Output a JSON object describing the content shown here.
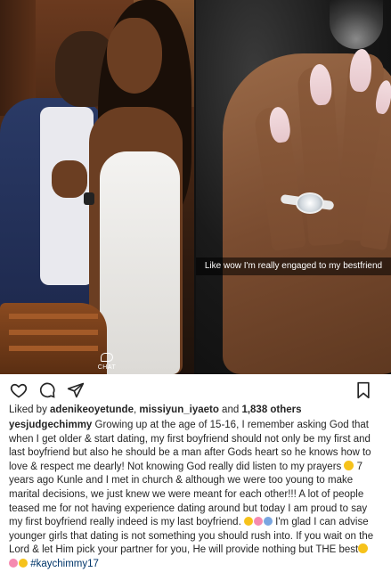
{
  "photos": {
    "left": {
      "chat_label": "CHAT"
    },
    "right": {
      "caption_text": "Like wow I'm really engaged to my bestfriend"
    }
  },
  "actions": {
    "icons": [
      "heart-icon",
      "comment-icon",
      "share-icon",
      "bookmark-icon"
    ]
  },
  "likes": {
    "prefix": "Liked by ",
    "user1": "adenikeoyetunde",
    "sep": ", ",
    "user2": "missiyun_iyaeto",
    "mid": " and ",
    "count": "1,838 others"
  },
  "caption": {
    "username": "yesjudgechimmy",
    "part1": " Growing up at the age of 15-16, I remember asking God that when I get older & start dating, my first boyfriend should not only be my first and last boyfriend but also he should be a man after Gods heart so he knows how to love & respect me dearly! Not knowing God really did listen to my prayers ",
    "part2": " 7 years ago Kunle and I met in church & although we were too young to make marital decisions, we just knew we were meant for each other!!! A lot of people teased me for not having experience dating around but today I am proud to say my first boyfriend really indeed is my last boyfriend. ",
    "part3": " I'm glad I can advise younger girls that dating is not something you should rush into. If you wait on the Lord & let Him pick your partner for you, He will provide nothing but THE best",
    "part4": " ",
    "hashtag": "#kaychimmy17"
  },
  "colors": {
    "text": "#262626",
    "hashtag": "#003569",
    "emoji_yellow": "#f6c21b",
    "emoji_ring": "#7aa6e0",
    "emoji_pink": "#f58ab0"
  }
}
